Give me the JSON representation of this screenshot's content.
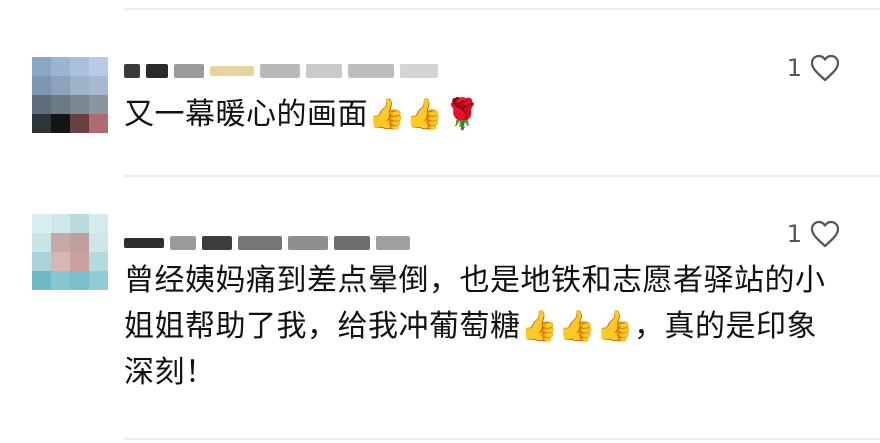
{
  "comments": [
    {
      "text": "又一幕暖心的画面👍👍🌹",
      "likes": "1",
      "username_blurred": true
    },
    {
      "text": "曾经姨妈痛到差点晕倒，也是地铁和志愿者驿站的小姐姐帮助了我，给我冲葡萄糖👍👍👍，真的是印象深刻！",
      "likes": "1",
      "username_blurred": true
    }
  ],
  "icons": {
    "like": "heart-outline-icon"
  },
  "colors": {
    "text": "#111111",
    "like": "#555555",
    "divider": "#ececec"
  }
}
